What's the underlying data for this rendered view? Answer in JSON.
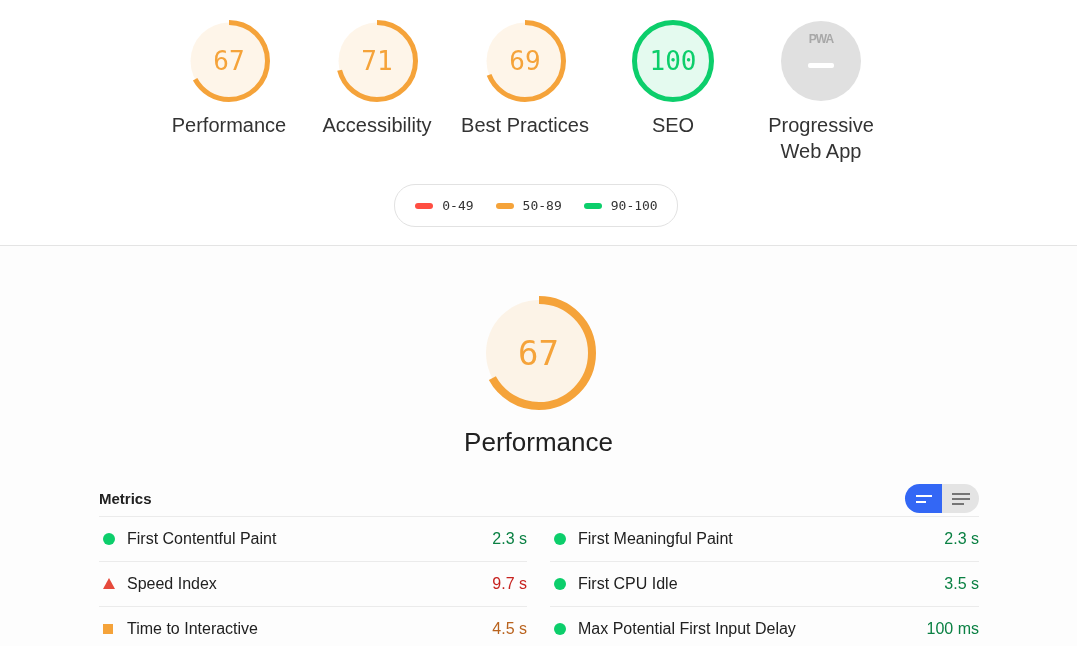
{
  "summary_gauges": [
    {
      "kind": "score",
      "label": "Performance",
      "score": "67",
      "color": "#f5a33a",
      "level": 0.67
    },
    {
      "kind": "score",
      "label": "Accessibility",
      "score": "71",
      "color": "#f5a33a",
      "level": 0.71
    },
    {
      "kind": "score",
      "label": "Best Practices",
      "score": "69",
      "color": "#f5a33a",
      "level": 0.69
    },
    {
      "kind": "score",
      "label": "SEO",
      "score": "100",
      "color": "#0cce6b",
      "level": 1.0
    },
    {
      "kind": "pwa",
      "label": "Progressive Web App",
      "badge": "PWA"
    }
  ],
  "legend": [
    {
      "color": "#ff4e42",
      "label": "0-49"
    },
    {
      "color": "#f5a33a",
      "label": "50-89"
    },
    {
      "color": "#0cce6b",
      "label": "90-100"
    }
  ],
  "category": {
    "score": "67",
    "color": "#f5a33a",
    "level": 0.67,
    "title": "Performance"
  },
  "metrics": {
    "title": "Metrics",
    "view_toggle": [
      {
        "kind": "compact",
        "selected": true
      },
      {
        "kind": "expanded",
        "selected": false
      }
    ],
    "items": [
      {
        "name": "First Contentful Paint",
        "value": "2.3 s",
        "kind": "pass"
      },
      {
        "name": "First Meaningful Paint",
        "value": "2.3 s",
        "kind": "pass"
      },
      {
        "name": "Speed Index",
        "value": "9.7 s",
        "kind": "fail"
      },
      {
        "name": "First CPU Idle",
        "value": "3.5 s",
        "kind": "pass"
      },
      {
        "name": "Time to Interactive",
        "value": "4.5 s",
        "kind": "average"
      },
      {
        "name": "Max Potential First Input Delay",
        "value": "100 ms",
        "kind": "pass"
      }
    ]
  }
}
